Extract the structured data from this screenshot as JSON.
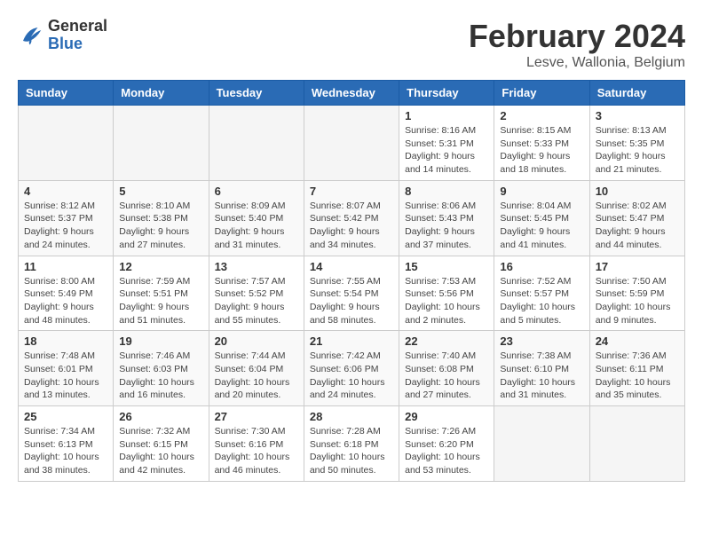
{
  "header": {
    "logo_general": "General",
    "logo_blue": "Blue",
    "month_year": "February 2024",
    "location": "Lesve, Wallonia, Belgium"
  },
  "weekdays": [
    "Sunday",
    "Monday",
    "Tuesday",
    "Wednesday",
    "Thursday",
    "Friday",
    "Saturday"
  ],
  "weeks": [
    [
      {
        "day": "",
        "info": ""
      },
      {
        "day": "",
        "info": ""
      },
      {
        "day": "",
        "info": ""
      },
      {
        "day": "",
        "info": ""
      },
      {
        "day": "1",
        "info": "Sunrise: 8:16 AM\nSunset: 5:31 PM\nDaylight: 9 hours\nand 14 minutes."
      },
      {
        "day": "2",
        "info": "Sunrise: 8:15 AM\nSunset: 5:33 PM\nDaylight: 9 hours\nand 18 minutes."
      },
      {
        "day": "3",
        "info": "Sunrise: 8:13 AM\nSunset: 5:35 PM\nDaylight: 9 hours\nand 21 minutes."
      }
    ],
    [
      {
        "day": "4",
        "info": "Sunrise: 8:12 AM\nSunset: 5:37 PM\nDaylight: 9 hours\nand 24 minutes."
      },
      {
        "day": "5",
        "info": "Sunrise: 8:10 AM\nSunset: 5:38 PM\nDaylight: 9 hours\nand 27 minutes."
      },
      {
        "day": "6",
        "info": "Sunrise: 8:09 AM\nSunset: 5:40 PM\nDaylight: 9 hours\nand 31 minutes."
      },
      {
        "day": "7",
        "info": "Sunrise: 8:07 AM\nSunset: 5:42 PM\nDaylight: 9 hours\nand 34 minutes."
      },
      {
        "day": "8",
        "info": "Sunrise: 8:06 AM\nSunset: 5:43 PM\nDaylight: 9 hours\nand 37 minutes."
      },
      {
        "day": "9",
        "info": "Sunrise: 8:04 AM\nSunset: 5:45 PM\nDaylight: 9 hours\nand 41 minutes."
      },
      {
        "day": "10",
        "info": "Sunrise: 8:02 AM\nSunset: 5:47 PM\nDaylight: 9 hours\nand 44 minutes."
      }
    ],
    [
      {
        "day": "11",
        "info": "Sunrise: 8:00 AM\nSunset: 5:49 PM\nDaylight: 9 hours\nand 48 minutes."
      },
      {
        "day": "12",
        "info": "Sunrise: 7:59 AM\nSunset: 5:51 PM\nDaylight: 9 hours\nand 51 minutes."
      },
      {
        "day": "13",
        "info": "Sunrise: 7:57 AM\nSunset: 5:52 PM\nDaylight: 9 hours\nand 55 minutes."
      },
      {
        "day": "14",
        "info": "Sunrise: 7:55 AM\nSunset: 5:54 PM\nDaylight: 9 hours\nand 58 minutes."
      },
      {
        "day": "15",
        "info": "Sunrise: 7:53 AM\nSunset: 5:56 PM\nDaylight: 10 hours\nand 2 minutes."
      },
      {
        "day": "16",
        "info": "Sunrise: 7:52 AM\nSunset: 5:57 PM\nDaylight: 10 hours\nand 5 minutes."
      },
      {
        "day": "17",
        "info": "Sunrise: 7:50 AM\nSunset: 5:59 PM\nDaylight: 10 hours\nand 9 minutes."
      }
    ],
    [
      {
        "day": "18",
        "info": "Sunrise: 7:48 AM\nSunset: 6:01 PM\nDaylight: 10 hours\nand 13 minutes."
      },
      {
        "day": "19",
        "info": "Sunrise: 7:46 AM\nSunset: 6:03 PM\nDaylight: 10 hours\nand 16 minutes."
      },
      {
        "day": "20",
        "info": "Sunrise: 7:44 AM\nSunset: 6:04 PM\nDaylight: 10 hours\nand 20 minutes."
      },
      {
        "day": "21",
        "info": "Sunrise: 7:42 AM\nSunset: 6:06 PM\nDaylight: 10 hours\nand 24 minutes."
      },
      {
        "day": "22",
        "info": "Sunrise: 7:40 AM\nSunset: 6:08 PM\nDaylight: 10 hours\nand 27 minutes."
      },
      {
        "day": "23",
        "info": "Sunrise: 7:38 AM\nSunset: 6:10 PM\nDaylight: 10 hours\nand 31 minutes."
      },
      {
        "day": "24",
        "info": "Sunrise: 7:36 AM\nSunset: 6:11 PM\nDaylight: 10 hours\nand 35 minutes."
      }
    ],
    [
      {
        "day": "25",
        "info": "Sunrise: 7:34 AM\nSunset: 6:13 PM\nDaylight: 10 hours\nand 38 minutes."
      },
      {
        "day": "26",
        "info": "Sunrise: 7:32 AM\nSunset: 6:15 PM\nDaylight: 10 hours\nand 42 minutes."
      },
      {
        "day": "27",
        "info": "Sunrise: 7:30 AM\nSunset: 6:16 PM\nDaylight: 10 hours\nand 46 minutes."
      },
      {
        "day": "28",
        "info": "Sunrise: 7:28 AM\nSunset: 6:18 PM\nDaylight: 10 hours\nand 50 minutes."
      },
      {
        "day": "29",
        "info": "Sunrise: 7:26 AM\nSunset: 6:20 PM\nDaylight: 10 hours\nand 53 minutes."
      },
      {
        "day": "",
        "info": ""
      },
      {
        "day": "",
        "info": ""
      }
    ]
  ]
}
